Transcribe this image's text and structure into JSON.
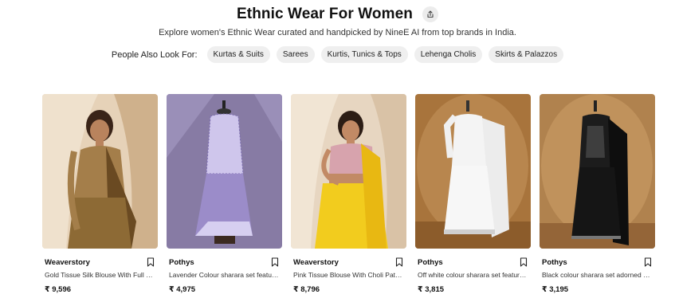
{
  "header": {
    "title": "Ethnic Wear For Women",
    "subtitle": "Explore women's Ethnic Wear curated and handpicked by NineE AI from top brands in India."
  },
  "related": {
    "label": "People Also Look For:",
    "pills": [
      "Kurtas & Suits",
      "Sarees",
      "Kurtis, Tunics & Tops",
      "Lehenga Cholis",
      "Skirts & Palazzos"
    ]
  },
  "products": [
    {
      "brand": "Weaverstory",
      "name": "Gold Tissue Silk Blouse With Full Sleeves",
      "price": "₹ 9,596",
      "bg": "#cdb08f",
      "garment": "#9a7a45"
    },
    {
      "brand": "Pothys",
      "name": "Lavender Colour sharara set featuring embroidery",
      "price": "₹ 4,975",
      "bg": "#8b7fa8",
      "garment": "#a89bd0"
    },
    {
      "brand": "Weaverstory",
      "name": "Pink Tissue Blouse With Choli Pattern",
      "price": "₹ 8,796",
      "bg": "#dccab3",
      "garment": "#f2cc1e"
    },
    {
      "brand": "Pothys",
      "name": "Off white colour sharara set featuring embroidery",
      "price": "₹ 3,815",
      "bg": "#a9763e",
      "garment": "#f2f2f2"
    },
    {
      "brand": "Pothys",
      "name": "Black colour sharara set adorned with embroidery",
      "price": "₹ 3,195",
      "bg": "#b58450",
      "garment": "#151515"
    }
  ]
}
